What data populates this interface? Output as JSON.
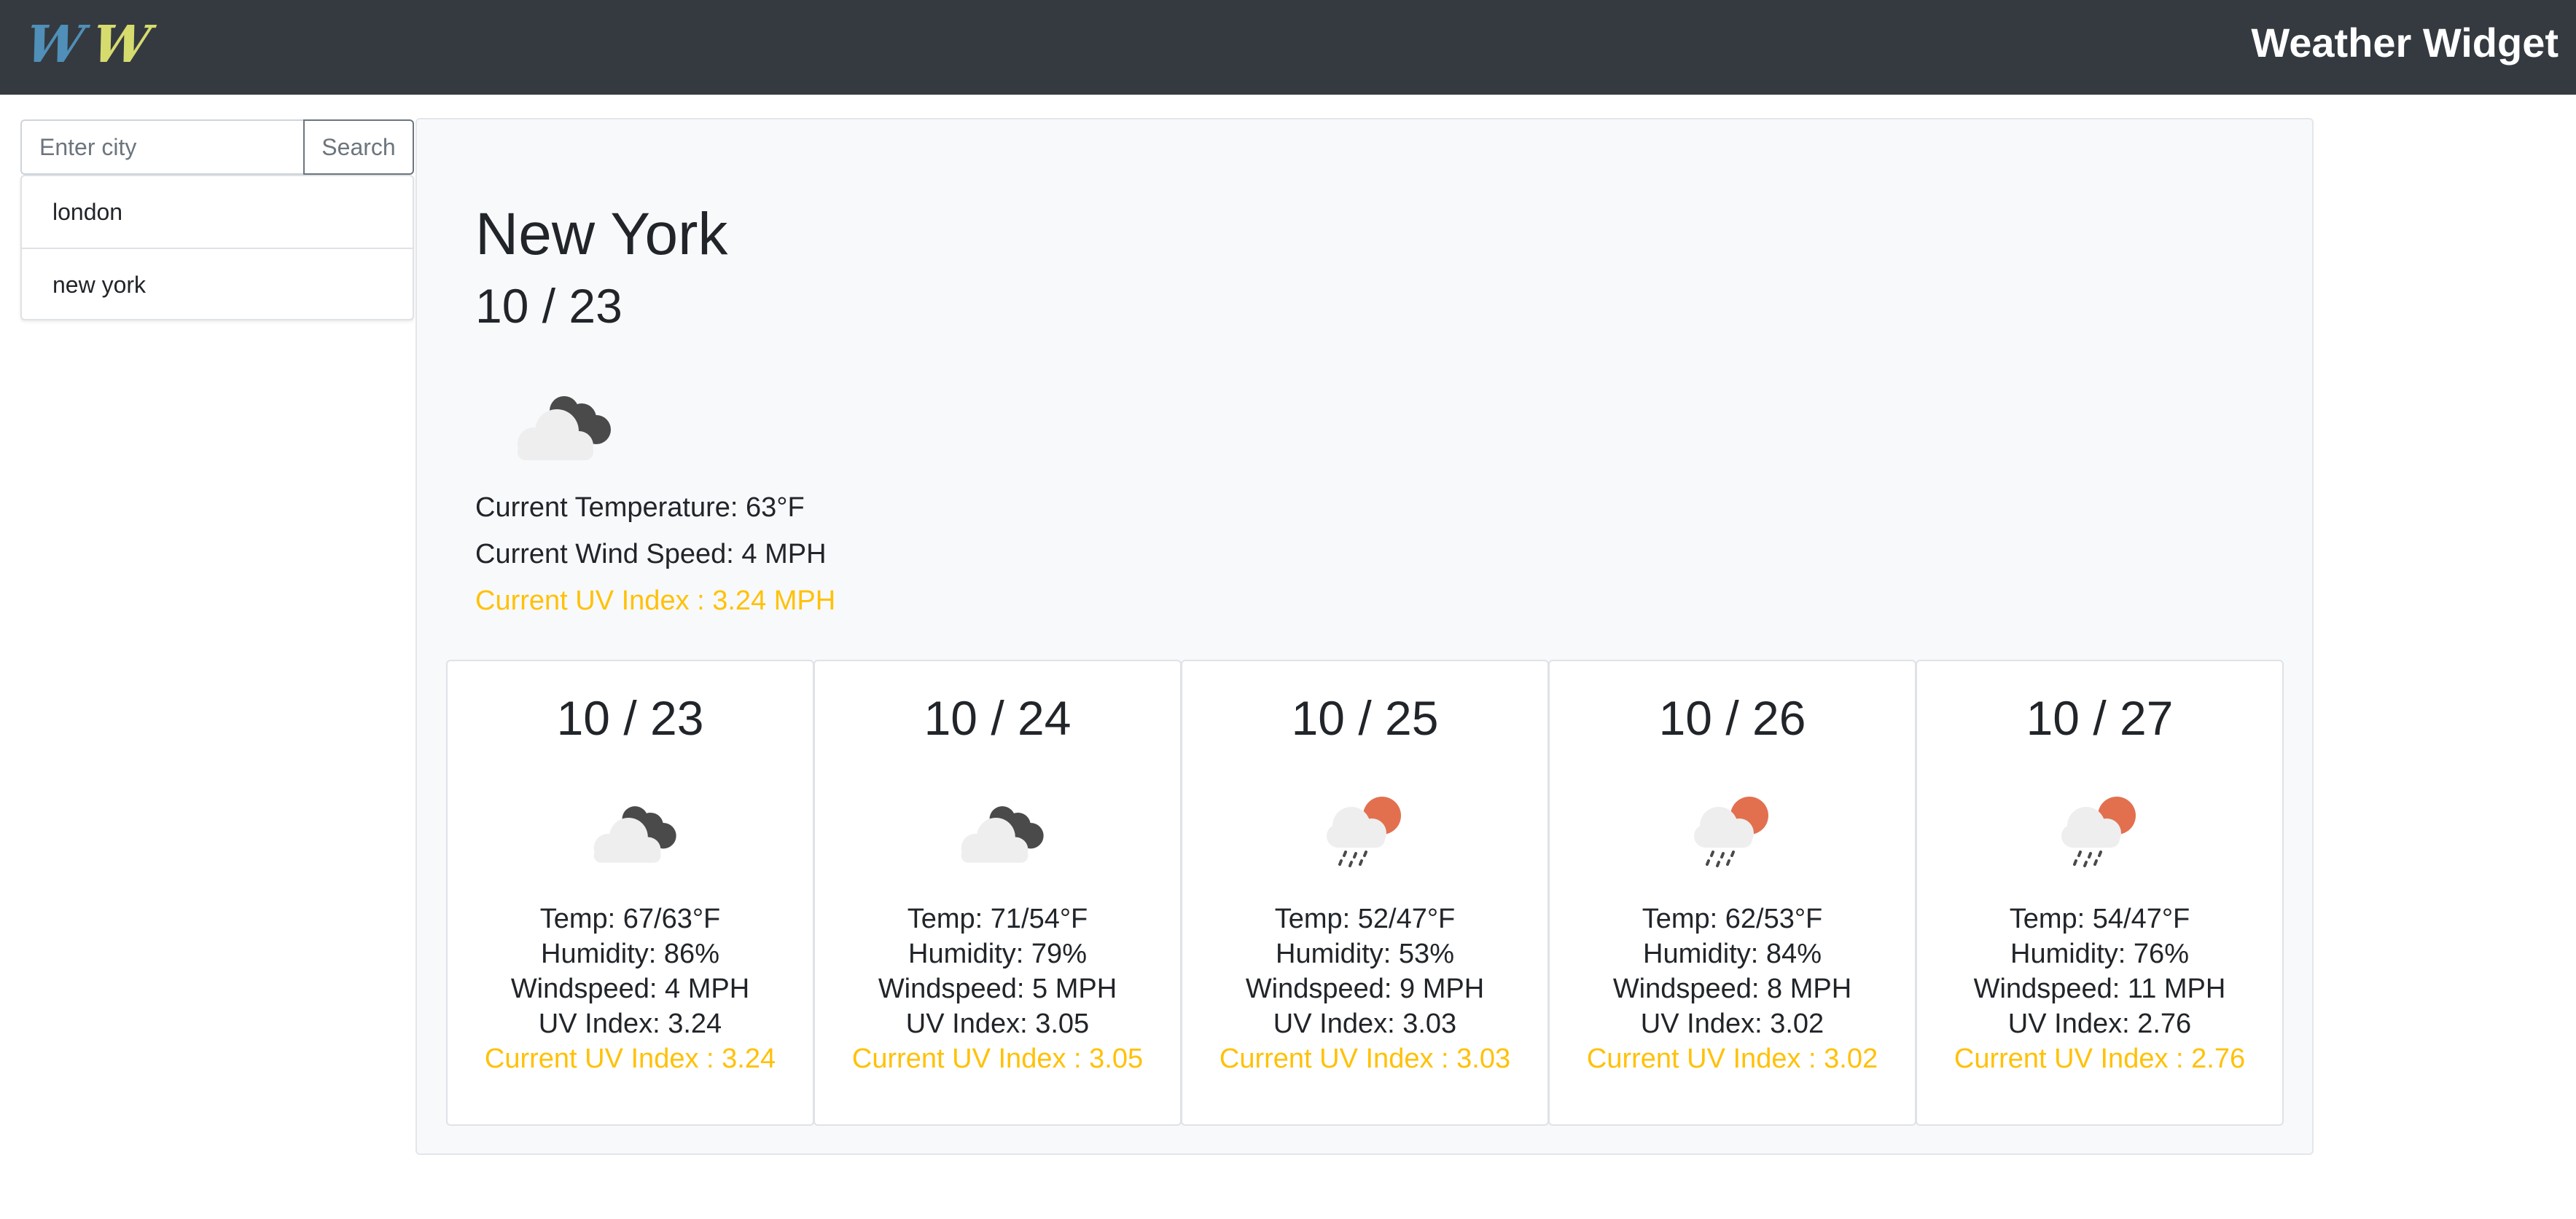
{
  "navbar": {
    "logo_letters": [
      "W",
      "W"
    ],
    "logo_colors": [
      "#4f8fb8",
      "#d6db6e"
    ],
    "title": "Weather Widget"
  },
  "search": {
    "placeholder": "Enter city",
    "value": "",
    "button_label": "Search"
  },
  "history": [
    "london",
    "new york"
  ],
  "current": {
    "city": "New York",
    "date": "10 / 23",
    "icon": "cloudy-night-icon",
    "temperature": "Current Temperature: 63°F",
    "wind": "Current Wind Speed: 4 MPH",
    "uv": "Current UV Index : 3.24 MPH"
  },
  "forecast": [
    {
      "date": "10 / 23",
      "icon": "cloudy-night-icon",
      "temp": "Temp: 67/63°F",
      "humidity": "Humidity: 86%",
      "windspeed": "Windspeed: 4 MPH",
      "uv": "UV Index: 3.24",
      "uv_current": "Current UV Index : 3.24"
    },
    {
      "date": "10 / 24",
      "icon": "cloudy-night-icon",
      "temp": "Temp: 71/54°F",
      "humidity": "Humidity: 79%",
      "windspeed": "Windspeed: 5 MPH",
      "uv": "UV Index: 3.05",
      "uv_current": "Current UV Index : 3.05"
    },
    {
      "date": "10 / 25",
      "icon": "rain-sun-icon",
      "temp": "Temp: 52/47°F",
      "humidity": "Humidity: 53%",
      "windspeed": "Windspeed: 9 MPH",
      "uv": "UV Index: 3.03",
      "uv_current": "Current UV Index : 3.03"
    },
    {
      "date": "10 / 26",
      "icon": "rain-sun-icon",
      "temp": "Temp: 62/53°F",
      "humidity": "Humidity: 84%",
      "windspeed": "Windspeed: 8 MPH",
      "uv": "UV Index: 3.02",
      "uv_current": "Current UV Index : 3.02"
    },
    {
      "date": "10 / 27",
      "icon": "rain-sun-icon",
      "temp": "Temp: 54/47°F",
      "humidity": "Humidity: 76%",
      "windspeed": "Windspeed: 11 MPH",
      "uv": "UV Index: 2.76",
      "uv_current": "Current UV Index : 2.76"
    }
  ],
  "colors": {
    "navbar_bg": "#343a40",
    "uv_accent": "#ffc107",
    "panel_bg": "#f8f9fa",
    "sun_orange": "#e2704f",
    "dark_cloud": "#4a4a4a",
    "light_cloud": "#eeeeee"
  }
}
